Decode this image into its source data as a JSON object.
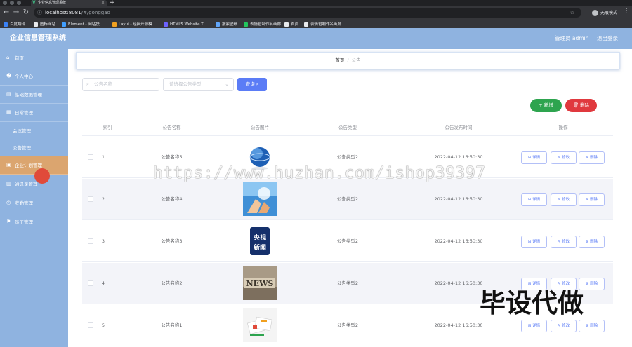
{
  "browser": {
    "tab_title": "企业信息管理系统",
    "url_host": "localhost:8081",
    "url_path": "/#/gonggao",
    "profile_label": "无痕模式",
    "bookmarks": [
      "百度翻译",
      "图标网站",
      "Element - 网站快...",
      "Layui - 经典开源模...",
      "HTML5 Website T...",
      "搜索壁纸",
      "表情包制作名画廊",
      "首页",
      "表情包制作名画廊"
    ]
  },
  "header": {
    "title": "企业信息管理系统",
    "user": "管理员 admin",
    "logout": "退出登录"
  },
  "sidebar": {
    "items": [
      {
        "label": "首页",
        "icon": "home-icon"
      },
      {
        "label": "个人中心",
        "icon": "user-icon"
      },
      {
        "label": "基础数据管理",
        "icon": "data-icon"
      },
      {
        "label": "日常管理",
        "icon": "calendar-icon"
      },
      {
        "label": "会议管理",
        "icon": ""
      },
      {
        "label": "公告管理",
        "icon": ""
      },
      {
        "label": "企业计划管理",
        "icon": "plan-icon"
      },
      {
        "label": "通讯录管理",
        "icon": "contacts-icon"
      },
      {
        "label": "考勤管理",
        "icon": "attendance-icon"
      },
      {
        "label": "员工管理",
        "icon": "staff-icon"
      }
    ]
  },
  "breadcrumb": {
    "home": "首页",
    "separator": "/",
    "current": "公告"
  },
  "search": {
    "name_placeholder": "公告名称",
    "type_placeholder": "请选择公告类型",
    "query_label": "查询"
  },
  "actions": {
    "add_label": "新增",
    "delete_label": "删除"
  },
  "table": {
    "columns": [
      "索引",
      "公告名称",
      "公告图片",
      "公告类型",
      "公告发布时间",
      "操作"
    ],
    "rows": [
      {
        "index": "1",
        "name": "公告名称5",
        "type": "公告类型2",
        "time": "2022-04-12 16:50:30",
        "image": "globe"
      },
      {
        "index": "2",
        "name": "公告名称4",
        "type": "公告类型2",
        "time": "2022-04-12 16:50:30",
        "image": "hands"
      },
      {
        "index": "3",
        "name": "公告名称3",
        "type": "公告类型2",
        "time": "2022-04-12 16:50:30",
        "image": "cctv-news"
      },
      {
        "index": "4",
        "name": "公告名称2",
        "type": "公告类型2",
        "time": "2022-04-12 16:50:30",
        "image": "news-blocks"
      },
      {
        "index": "5",
        "name": "公告名称1",
        "type": "公告类型2",
        "time": "2022-04-12 16:50:30",
        "image": "cards"
      }
    ],
    "row_actions": {
      "detail": "详情",
      "edit": "修改",
      "delete": "删除"
    }
  },
  "overlay": {
    "watermark": "https://www.huzhan.com/ishop39397",
    "stamp": "毕设代做"
  },
  "thumb_text": {
    "cctv_top": "央视",
    "cctv_bottom": "新闻",
    "news": "NEWS"
  },
  "colors": {
    "primary": "#5b7cf6",
    "success": "#2ea44f",
    "danger": "#e0393e",
    "theme": "#8fb3e0",
    "active_menu": "#dba56f"
  }
}
